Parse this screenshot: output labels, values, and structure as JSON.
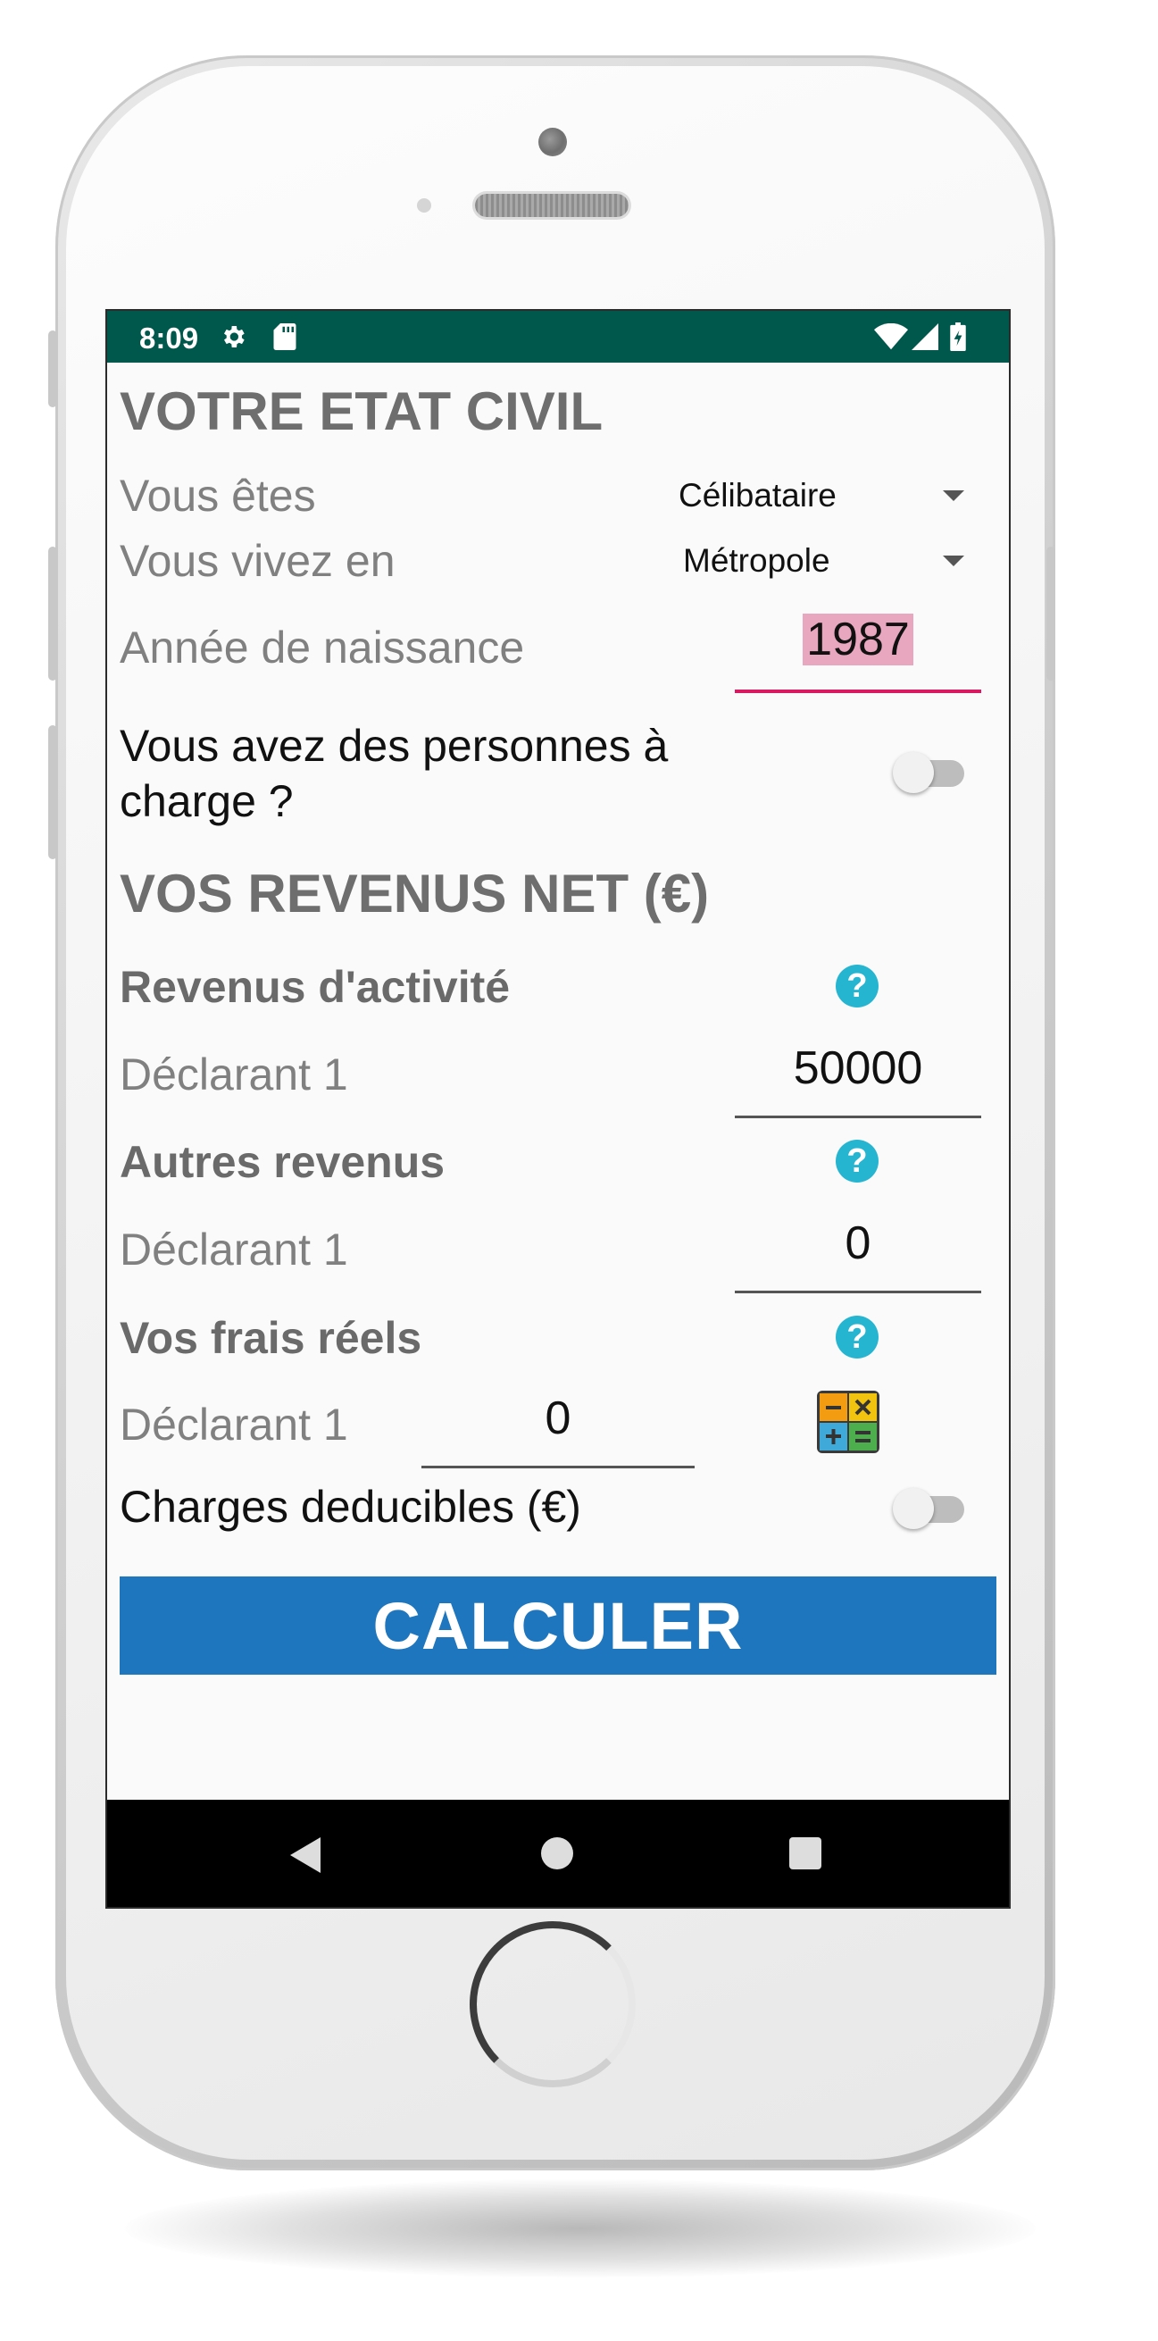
{
  "status_bar": {
    "time": "8:09",
    "icons": [
      "gear-icon",
      "sd-card-icon",
      "wifi-icon",
      "signal-icon",
      "battery-icon"
    ]
  },
  "etat_civil": {
    "title": "VOTRE ETAT CIVIL",
    "situation_label": "Vous êtes",
    "situation_value": "Célibataire",
    "residence_label": "Vous vivez en",
    "residence_value": "Métropole",
    "birth_year_label": "Année de naissance",
    "birth_year_value": "1987",
    "dependents_label": "Vous avez des personnes à charge ?",
    "dependents_on": false
  },
  "revenus": {
    "title": "VOS REVENUS NET (€)",
    "activity": {
      "label": "Revenus d'activité",
      "declarant_label": "Déclarant 1",
      "declarant_value": "50000"
    },
    "other": {
      "label": "Autres revenus",
      "declarant_label": "Déclarant 1",
      "declarant_value": "0"
    },
    "expenses": {
      "label": "Vos frais réels",
      "declarant_label": "Déclarant 1",
      "declarant_value": "0"
    },
    "deductible_label": "Charges deducibles (€)",
    "deductible_on": false,
    "help_glyph": "?"
  },
  "calculate_label": "CALCULER",
  "colors": {
    "status_bar": "#00574b",
    "button": "#1e76be",
    "help": "#26b5d1",
    "focus_underline": "#d81b60"
  }
}
